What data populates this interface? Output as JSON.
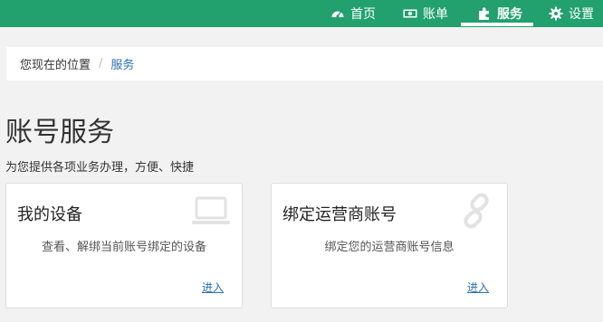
{
  "nav": {
    "items": [
      {
        "label": "首页",
        "icon": "dashboard-icon"
      },
      {
        "label": "账单",
        "icon": "money-icon"
      },
      {
        "label": "服务",
        "icon": "puzzle-icon",
        "active": true
      },
      {
        "label": "设置",
        "icon": "gear-icon"
      }
    ],
    "bg_color": "#22a06e"
  },
  "breadcrumb": {
    "prefix": "您现在的位置",
    "separator": "/",
    "current": "服务"
  },
  "page": {
    "title": "账号服务",
    "subtitle": "为您提供各项业务办理，方便、快捷"
  },
  "cards": [
    {
      "title": "我的设备",
      "desc": "查看、解绑当前账号绑定的设备",
      "link": "进入",
      "icon": "laptop-icon"
    },
    {
      "title": "绑定运营商账号",
      "desc": "绑定您的运营商账号信息",
      "link": "进入",
      "icon": "link-icon"
    }
  ],
  "colors": {
    "accent": "#22a06e",
    "link": "#2a6fb5"
  }
}
